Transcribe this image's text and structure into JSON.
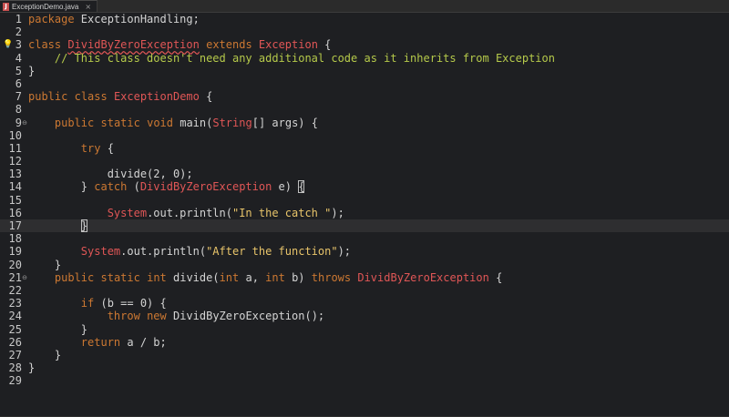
{
  "tab": {
    "title": "ExceptionDemo.java",
    "icon": "java-file-icon",
    "close": "×"
  },
  "colors": {
    "keyword": "#cc7832",
    "string": "#e8c46a",
    "comment": "#b5c94a",
    "class": "#e05656",
    "text": "#d4d4d4",
    "background": "#1e1f22"
  },
  "lines": [
    {
      "n": "1",
      "tokens": [
        [
          "kw",
          "package"
        ],
        [
          "t",
          " ExceptionHandling;"
        ]
      ]
    },
    {
      "n": "2",
      "tokens": []
    },
    {
      "n": "3",
      "marker": "lightbulb",
      "tokens": [
        [
          "kw",
          "class"
        ],
        [
          "t",
          " "
        ],
        [
          "clsu",
          "DividByZeroException"
        ],
        [
          "t",
          " "
        ],
        [
          "kw",
          "extends"
        ],
        [
          "t",
          " "
        ],
        [
          "cls",
          "Exception"
        ],
        [
          "t",
          " {"
        ]
      ]
    },
    {
      "n": "4",
      "tokens": [
        [
          "t",
          "    "
        ],
        [
          "cmt",
          "// This class doesn't need any additional code as it inherits from Exception"
        ]
      ]
    },
    {
      "n": "5",
      "tokens": [
        [
          "t",
          "}"
        ]
      ]
    },
    {
      "n": "6",
      "tokens": []
    },
    {
      "n": "7",
      "tokens": [
        [
          "kw",
          "public"
        ],
        [
          "t",
          " "
        ],
        [
          "kw",
          "class"
        ],
        [
          "t",
          " "
        ],
        [
          "cls",
          "ExceptionDemo"
        ],
        [
          "t",
          " {"
        ]
      ]
    },
    {
      "n": "8",
      "tokens": []
    },
    {
      "n": "9",
      "fold": "⊖",
      "tokens": [
        [
          "t",
          "    "
        ],
        [
          "kw",
          "public"
        ],
        [
          "t",
          " "
        ],
        [
          "kw",
          "static"
        ],
        [
          "t",
          " "
        ],
        [
          "kw",
          "void"
        ],
        [
          "t",
          " main("
        ],
        [
          "cls",
          "String"
        ],
        [
          "t",
          "[] args) {"
        ]
      ]
    },
    {
      "n": "10",
      "tokens": []
    },
    {
      "n": "11",
      "tokens": [
        [
          "t",
          "        "
        ],
        [
          "kw",
          "try"
        ],
        [
          "t",
          " {"
        ]
      ]
    },
    {
      "n": "12",
      "tokens": []
    },
    {
      "n": "13",
      "tokens": [
        [
          "t",
          "            divide(2, 0);"
        ]
      ]
    },
    {
      "n": "14",
      "tokens": [
        [
          "t",
          "        } "
        ],
        [
          "kw",
          "catch"
        ],
        [
          "t",
          " ("
        ],
        [
          "cls",
          "DividByZeroException"
        ],
        [
          "t",
          " e) "
        ],
        [
          "box",
          "{"
        ]
      ]
    },
    {
      "n": "15",
      "tokens": []
    },
    {
      "n": "16",
      "tokens": [
        [
          "t",
          "            "
        ],
        [
          "cls",
          "System"
        ],
        [
          "t",
          ".out.println("
        ],
        [
          "str",
          "\"In the catch \""
        ],
        [
          "t",
          ");"
        ]
      ]
    },
    {
      "n": "17",
      "current": true,
      "tokens": [
        [
          "t",
          "        "
        ],
        [
          "box",
          "}"
        ]
      ]
    },
    {
      "n": "18",
      "tokens": []
    },
    {
      "n": "19",
      "tokens": [
        [
          "t",
          "        "
        ],
        [
          "cls",
          "System"
        ],
        [
          "t",
          ".out.println("
        ],
        [
          "str",
          "\"After the function\""
        ],
        [
          "t",
          ");"
        ]
      ]
    },
    {
      "n": "20",
      "tokens": [
        [
          "t",
          "    }"
        ]
      ]
    },
    {
      "n": "21",
      "fold": "⊖",
      "tokens": [
        [
          "t",
          "    "
        ],
        [
          "kw",
          "public"
        ],
        [
          "t",
          " "
        ],
        [
          "kw",
          "static"
        ],
        [
          "t",
          " "
        ],
        [
          "kw",
          "int"
        ],
        [
          "t",
          " divide("
        ],
        [
          "kw",
          "int"
        ],
        [
          "t",
          " a, "
        ],
        [
          "kw",
          "int"
        ],
        [
          "t",
          " b) "
        ],
        [
          "kw",
          "throws"
        ],
        [
          "t",
          " "
        ],
        [
          "cls",
          "DividByZeroException"
        ],
        [
          "t",
          " {"
        ]
      ]
    },
    {
      "n": "22",
      "tokens": []
    },
    {
      "n": "23",
      "tokens": [
        [
          "t",
          "        "
        ],
        [
          "kw",
          "if"
        ],
        [
          "t",
          " (b == 0) {"
        ]
      ]
    },
    {
      "n": "24",
      "tokens": [
        [
          "t",
          "            "
        ],
        [
          "kw",
          "throw"
        ],
        [
          "t",
          " "
        ],
        [
          "kw",
          "new"
        ],
        [
          "t",
          " DividByZeroException();"
        ]
      ]
    },
    {
      "n": "25",
      "tokens": [
        [
          "t",
          "        }"
        ]
      ]
    },
    {
      "n": "26",
      "tokens": [
        [
          "t",
          "        "
        ],
        [
          "kw",
          "return"
        ],
        [
          "t",
          " a / b;"
        ]
      ]
    },
    {
      "n": "27",
      "tokens": [
        [
          "t",
          "    }"
        ]
      ]
    },
    {
      "n": "28",
      "tokens": [
        [
          "t",
          "}"
        ]
      ]
    },
    {
      "n": "29",
      "tokens": []
    }
  ]
}
